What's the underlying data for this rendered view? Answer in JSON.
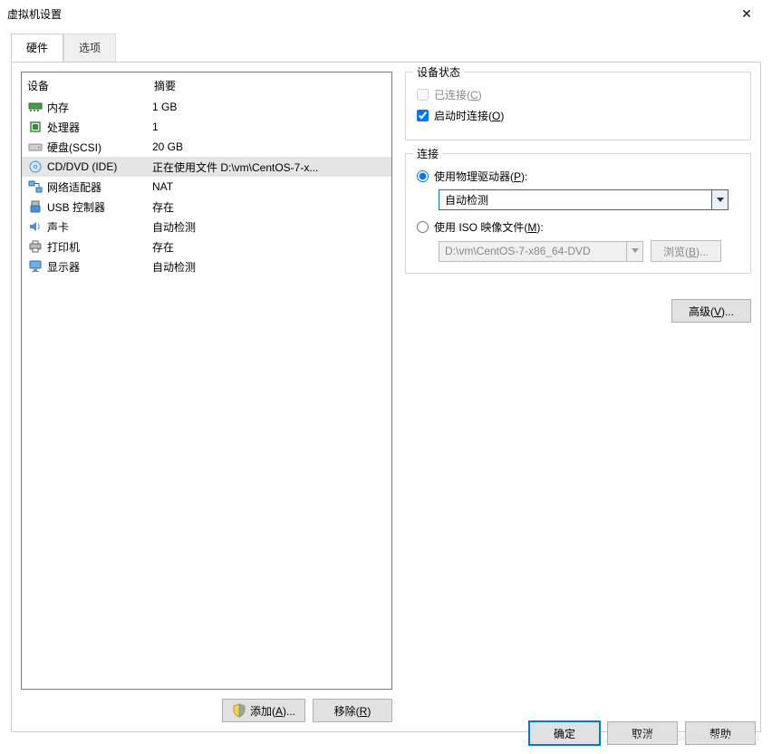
{
  "window": {
    "title": "虚拟机设置"
  },
  "tabs": {
    "hardware": "硬件",
    "options": "选项"
  },
  "list": {
    "header": {
      "device": "设备",
      "summary": "摘要"
    },
    "rows": [
      {
        "name": "内存",
        "summary": "1 GB"
      },
      {
        "name": "处理器",
        "summary": "1"
      },
      {
        "name": "硬盘(SCSI)",
        "summary": "20 GB"
      },
      {
        "name": "CD/DVD (IDE)",
        "summary": "正在使用文件 D:\\vm\\CentOS-7-x..."
      },
      {
        "name": "网络适配器",
        "summary": "NAT"
      },
      {
        "name": "USB 控制器",
        "summary": "存在"
      },
      {
        "name": "声卡",
        "summary": "自动检测"
      },
      {
        "name": "打印机",
        "summary": "存在"
      },
      {
        "name": "显示器",
        "summary": "自动检测"
      }
    ],
    "selected_index": 3
  },
  "left_buttons": {
    "add": {
      "label": "添加(",
      "hotkey": "A",
      "suffix": ")..."
    },
    "remove": {
      "label": "移除(",
      "hotkey": "R",
      "suffix": ")"
    }
  },
  "right": {
    "status": {
      "legend": "设备状态",
      "connected": {
        "label": "已连接(",
        "hotkey": "C",
        "suffix": ")"
      },
      "connect_on_power": {
        "label": "启动时连接(",
        "hotkey": "O",
        "suffix": ")"
      }
    },
    "connection": {
      "legend": "连接",
      "use_physical": {
        "label": "使用物理驱动器(",
        "hotkey": "P",
        "suffix": "):"
      },
      "physical_value": "自动检测",
      "use_iso": {
        "label": "使用 ISO 映像文件(",
        "hotkey": "M",
        "suffix": "):"
      },
      "iso_value": "D:\\vm\\CentOS-7-x86_64-DVD",
      "browse": {
        "label": "浏览(",
        "hotkey": "B",
        "suffix": ")..."
      }
    },
    "advanced": {
      "label": "高级(",
      "hotkey": "V",
      "suffix": ")..."
    }
  },
  "footer": {
    "ok": "确定",
    "cancel": "取消",
    "help": "帮助"
  },
  "watermark": "https://blog.csdn.net/superzhou"
}
